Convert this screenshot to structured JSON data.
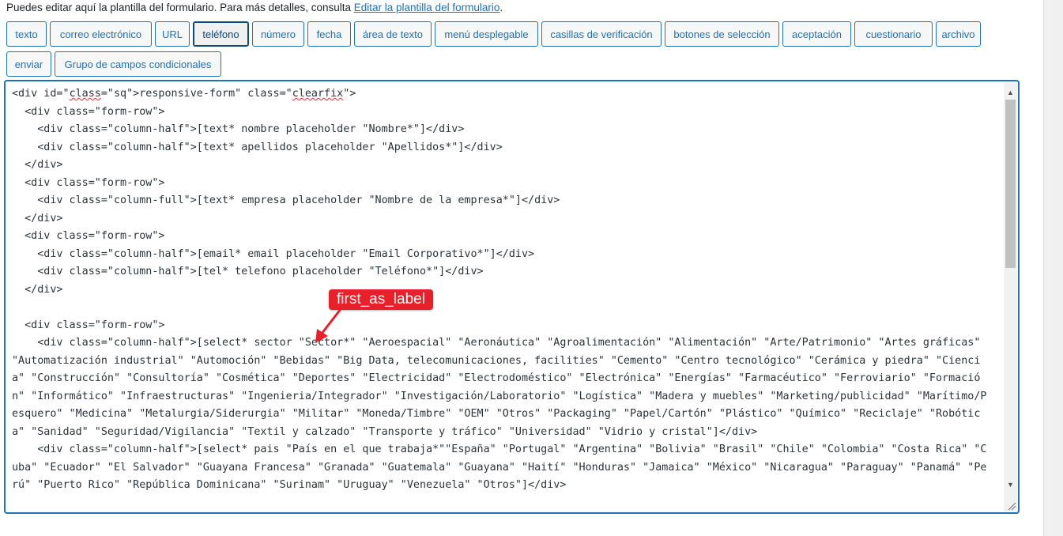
{
  "intro": {
    "text": "Puedes editar aquí la plantilla del formulario. Para más detalles, consulta ",
    "link": "Editar la plantilla del formulario",
    "suffix": "."
  },
  "tags": [
    {
      "label": "texto"
    },
    {
      "label": "correo electrónico"
    },
    {
      "label": "URL"
    },
    {
      "label": "teléfono",
      "active": true
    },
    {
      "label": "número"
    },
    {
      "label": "fecha"
    },
    {
      "label": "área de texto"
    },
    {
      "label": "menú desplegable"
    },
    {
      "label": "casillas de verificación"
    },
    {
      "label": "botones de selección"
    },
    {
      "label": "aceptación"
    },
    {
      "label": "cuestionario"
    },
    {
      "label": "archivo"
    },
    {
      "label": "enviar"
    },
    {
      "label": "Grupo de campos condicionales"
    }
  ],
  "editor": {
    "lines": [
      "<div id=\"responsive-form\" class=\"clearfix\">",
      "  <div class=\"form-row\">",
      "    <div class=\"column-half\">[text* nombre placeholder \"Nombre*\"]</div>",
      "    <div class=\"column-half\">[text* apellidos placeholder \"Apellidos*\"]</div>",
      "  </div>",
      "  <div class=\"form-row\">",
      "    <div class=\"column-full\">[text* empresa placeholder \"Nombre de la empresa*\"]</div>",
      "  </div>",
      "  <div class=\"form-row\">",
      "    <div class=\"column-half\">[email* email placeholder \"Email Corporativo*\"]</div>",
      "    <div class=\"column-half\">[tel* telefono placeholder \"Teléfono*\"]</div>",
      "  </div>",
      "",
      "  <div class=\"form-row\">",
      "    <div class=\"column-half\">[select* sector \"Sector*\" \"Aeroespacial\" \"Aeronáutica\" \"Agroalimentación\" \"Alimentación\" \"Arte/Patrimonio\" \"Artes gráficas\" \"Automatización industrial\" \"Automoción\" \"Bebidas\" \"Big Data, telecomunicaciones, facilities\" \"Cemento\" \"Centro tecnológico\" \"Cerámica y piedra\" \"Ciencia\" \"Construcción\" \"Consultoría\" \"Cosmética\" \"Deportes\" \"Electricidad\" \"Electrodoméstico\" \"Electrónica\" \"Energías\" \"Farmacéutico\" \"Ferroviario\" \"Formación\" \"Informático\" \"Infraestructuras\" \"Ingenieria/Integrador\" \"Investigación/Laboratorio\" \"Logística\" \"Madera y muebles\" \"Marketing/publicidad\" \"Marítimo/Pesquero\" \"Medicina\" \"Metalurgia/Siderurgia\" \"Militar\" \"Moneda/Timbre\" \"OEM\" \"Otros\" \"Packaging\" \"Papel/Cartón\" \"Plástico\" \"Químico\" \"Reciclaje\" \"Robótica\" \"Sanidad\" \"Seguridad/Vigilancia\" \"Textil y calzado\" \"Transporte y tráfico\" \"Universidad\" \"Vidrio y cristal\"]</div>",
      "    <div class=\"column-half\">[select* pais \"País en el que trabaja*\"\"España\" \"Portugal\" \"Argentina\" \"Bolivia\" \"Brasil\" \"Chile\" \"Colombia\" \"Costa Rica\" \"Cuba\" \"Ecuador\" \"El Salvador\" \"Guayana Francesa\" \"Granada\" \"Guatemala\" \"Guayana\" \"Haití\" \"Honduras\" \"Jamaica\" \"México\" \"Nicaragua\" \"Paraguay\" \"Panamá\" \"Perú\" \"Puerto Rico\" \"República Dominicana\" \"Surinam\" \"Uruguay\" \"Venezuela\" \"Otros\"]</div>"
    ]
  },
  "callout": {
    "label": "first_as_label",
    "color": "#e8202a"
  }
}
